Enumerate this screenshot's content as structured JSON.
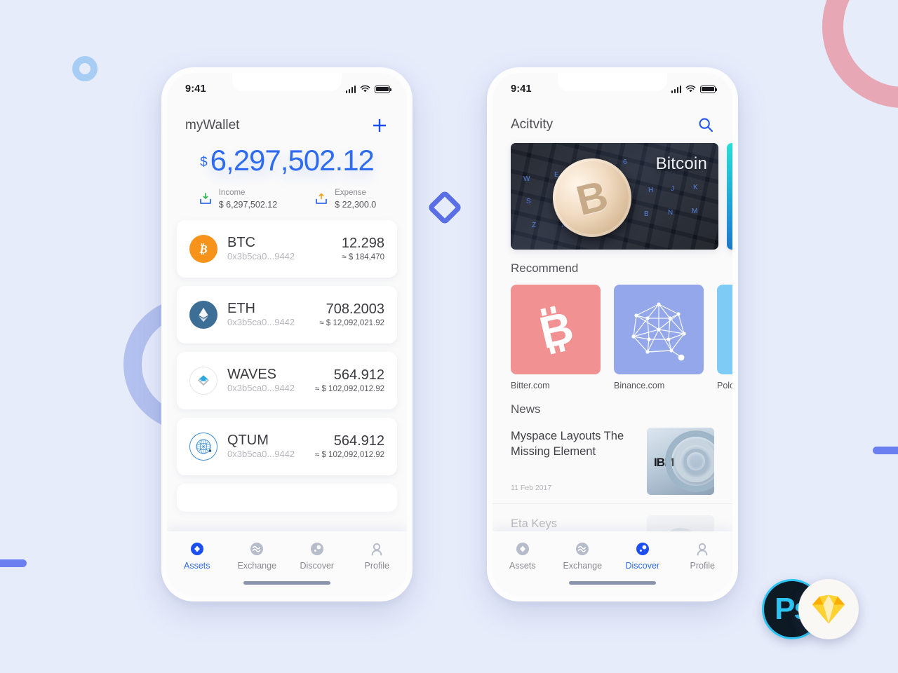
{
  "canvas": {
    "background_color": "#e7ecfb",
    "decorations": [
      {
        "name": "ring-small",
        "color": "#a7cdf5"
      },
      {
        "name": "ring-pink",
        "color": "#e7a7b4"
      },
      {
        "name": "ring-purple",
        "color": "#b3c1ef"
      },
      {
        "name": "bar-left",
        "color": "#6b7ff0"
      },
      {
        "name": "bar-right",
        "color": "#6b7ff0"
      },
      {
        "name": "diamond-mid",
        "color": "#5b6fe6"
      }
    ]
  },
  "badges": [
    {
      "name": "photoshop-badge",
      "label": "Ps",
      "color": "#2bc4f3"
    },
    {
      "name": "sketch-badge",
      "label": "sketch-diamond-icon",
      "color": "#f7a81b"
    }
  ],
  "wallet_screen": {
    "status_bar": {
      "time": "9:41",
      "signal": "signal-icon",
      "wifi": "wifi-icon",
      "battery": "battery-icon"
    },
    "title": "myWallet",
    "add_button": "+",
    "balance": {
      "currency": "$",
      "amount": "6,297,502.12",
      "accent_color": "#2f6bf0"
    },
    "income": {
      "label": "Income",
      "value": "$ 6,297,502.12",
      "arrow_color": "#34b357"
    },
    "expense": {
      "label": "Expense",
      "value": "$ 22,300.0",
      "arrow_color": "#f5a623"
    },
    "assets": [
      {
        "symbol": "BTC",
        "address": "0x3b5ca0...9442",
        "quantity": "12.298",
        "fiat": "≈ $ 184,470",
        "icon": "bitcoin-icon",
        "icon_bg": "#f7931a"
      },
      {
        "symbol": "ETH",
        "address": "0x3b5ca0...9442",
        "quantity": "708.2003",
        "fiat": "≈ $ 12,092,021.92",
        "icon": "ethereum-icon",
        "icon_bg": "#3c6e96"
      },
      {
        "symbol": "WAVES",
        "address": "0x3b5ca0...9442",
        "quantity": "564.912",
        "fiat": "≈ $ 102,092,012.92",
        "icon": "waves-icon",
        "icon_bg": "#ffffff"
      },
      {
        "symbol": "QTUM",
        "address": "0x3b5ca0...9442",
        "quantity": "564.912",
        "fiat": "≈ $ 102,092,012.92",
        "icon": "qtum-icon",
        "icon_bg": "#ffffff"
      }
    ],
    "tabs": [
      {
        "label": "Assets",
        "icon": "diamond-icon",
        "active": true
      },
      {
        "label": "Exchange",
        "icon": "exchange-icon",
        "active": false
      },
      {
        "label": "Discover",
        "icon": "compass-icon",
        "active": false
      },
      {
        "label": "Profile",
        "icon": "person-icon",
        "active": false
      }
    ]
  },
  "discover_screen": {
    "status_bar": {
      "time": "9:41",
      "signal": "signal-icon",
      "wifi": "wifi-icon",
      "battery": "battery-icon"
    },
    "title": "Acitvity",
    "search_icon": "search-icon",
    "carousel": [
      {
        "caption": "Bitcoin",
        "name": "bitcoin-keyboard-banner"
      },
      {
        "caption": "",
        "name": "aurora-banner"
      }
    ],
    "recommend": {
      "heading": "Recommend",
      "items": [
        {
          "name": "Bitter.com",
          "icon": "bitcoin-b-icon",
          "color": "#f29191"
        },
        {
          "name": "Binance.com",
          "icon": "network-graph-icon",
          "color": "#93a7ea"
        },
        {
          "name": "Polone",
          "icon": "",
          "color": "#7ecbf5"
        }
      ]
    },
    "news": {
      "heading": "News",
      "items": [
        {
          "title": "Myspace Layouts The Missing Element",
          "date": "11 Feb 2017",
          "thumb": "ibm-server-thumb"
        },
        {
          "title": "Eta Keys",
          "date": "",
          "thumb": "portrait-thumb"
        }
      ]
    },
    "tabs": [
      {
        "label": "Assets",
        "icon": "diamond-icon",
        "active": false
      },
      {
        "label": "Exchange",
        "icon": "exchange-icon",
        "active": false
      },
      {
        "label": "Discover",
        "icon": "compass-icon",
        "active": true
      },
      {
        "label": "Profile",
        "icon": "person-icon",
        "active": false
      }
    ]
  }
}
